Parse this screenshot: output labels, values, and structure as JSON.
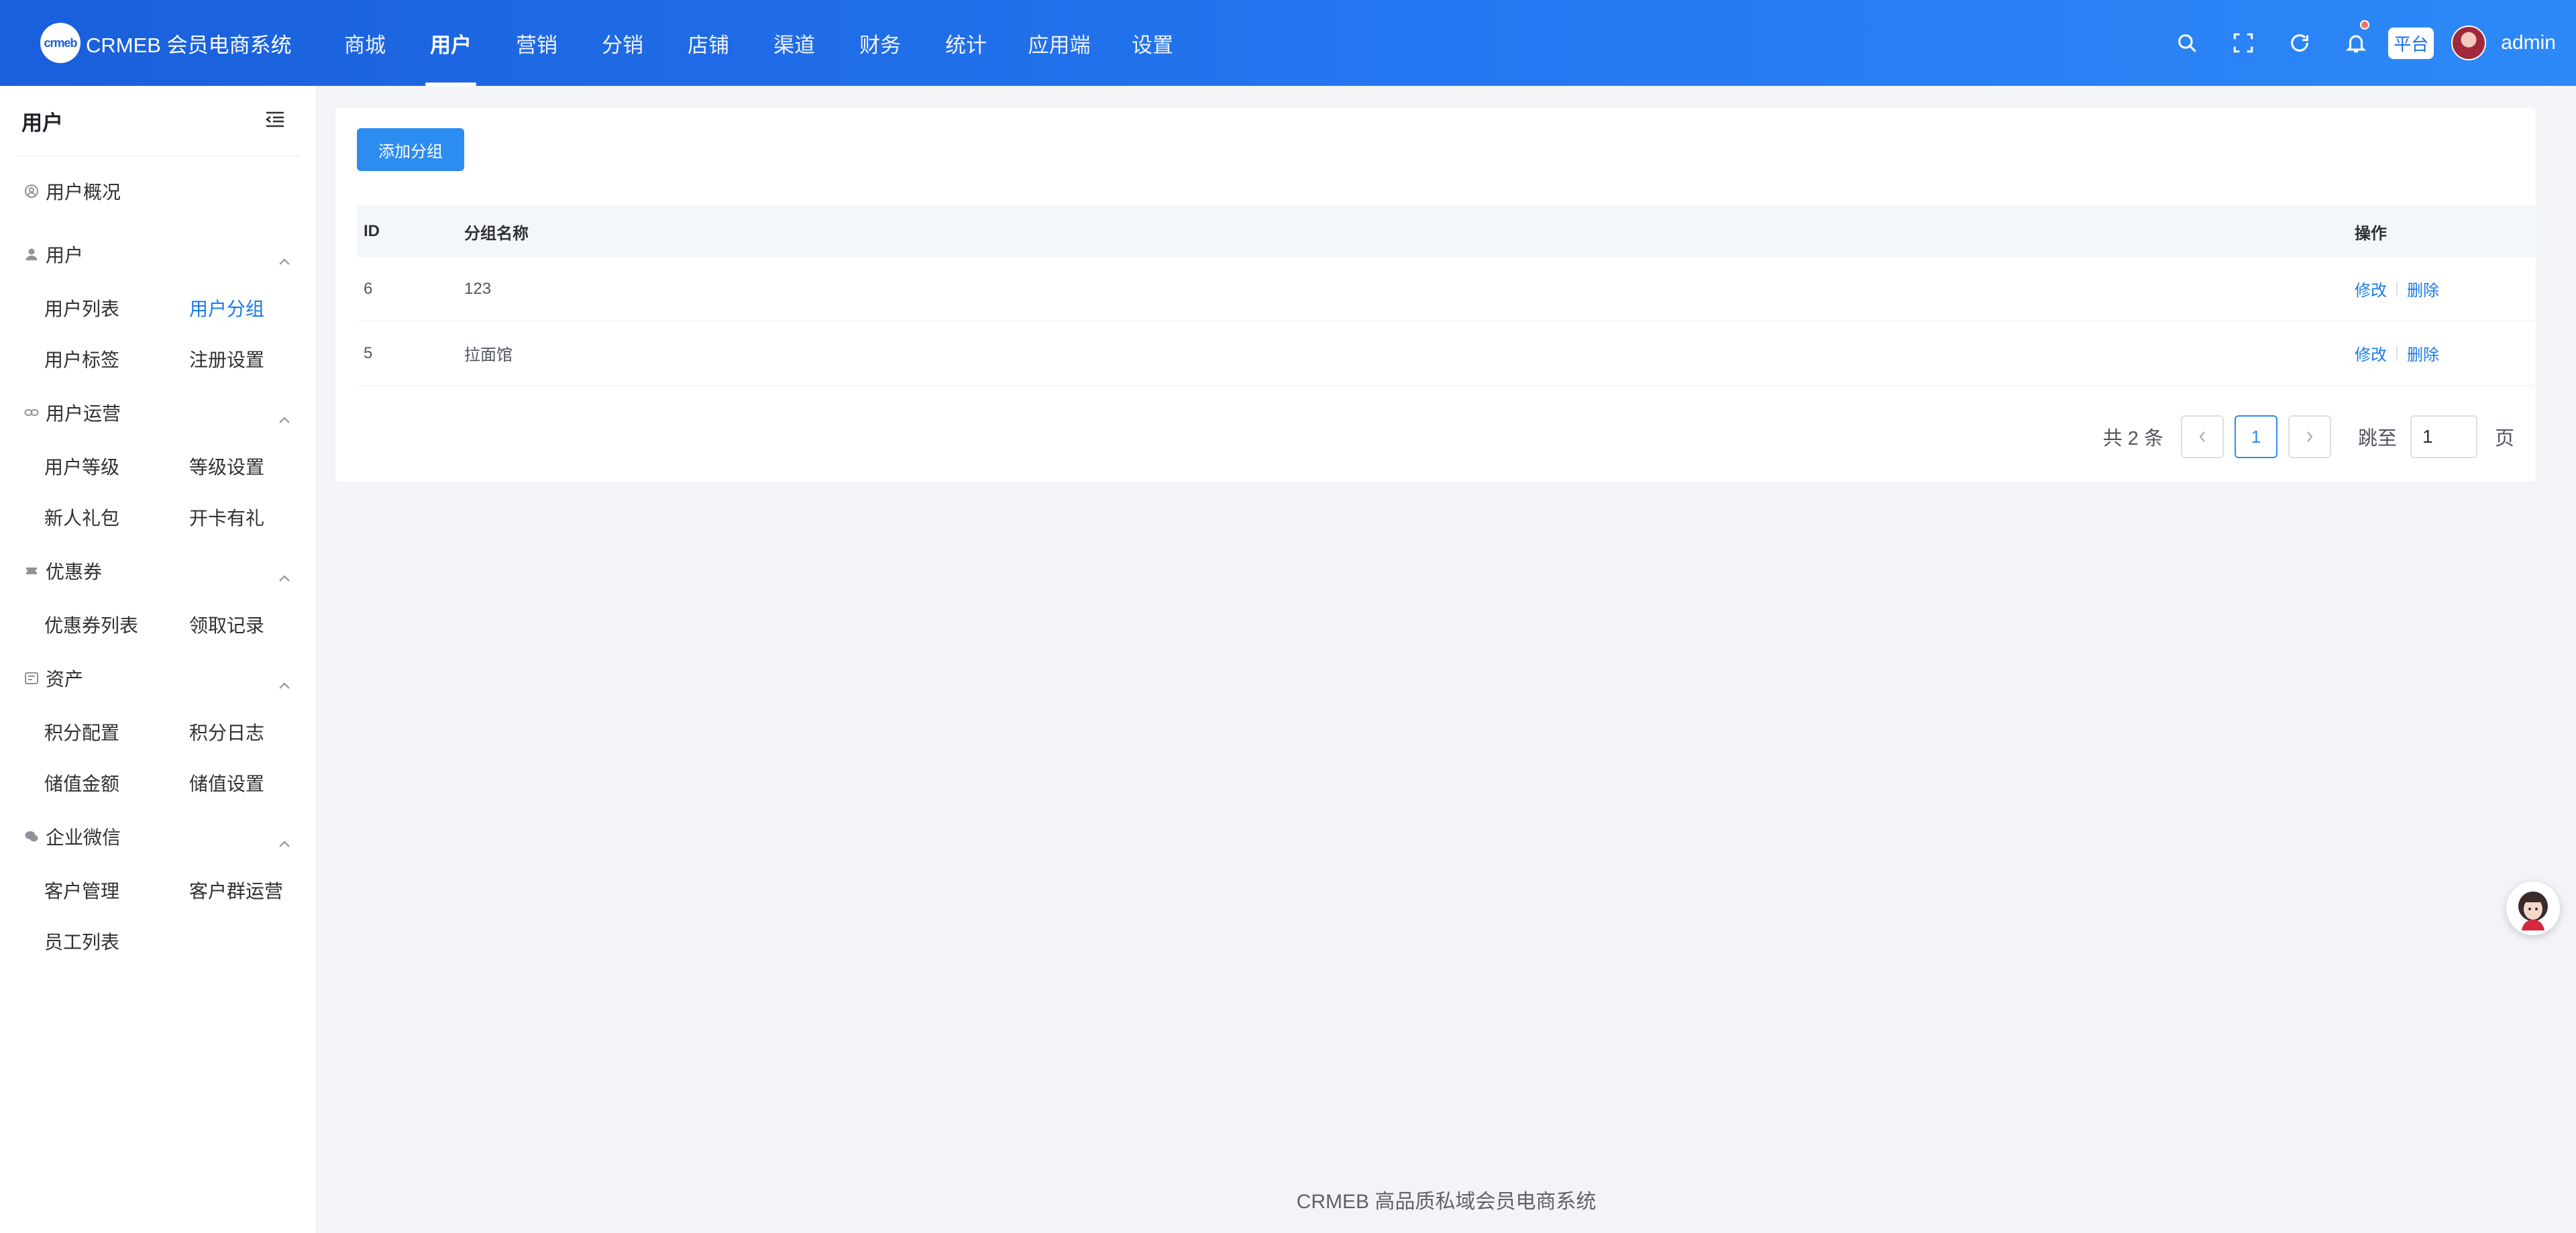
{
  "brand": {
    "logo_text": "crmeb",
    "name": "CRMEB 会员电商系统"
  },
  "topnav": {
    "items": [
      {
        "label": "商城"
      },
      {
        "label": "用户"
      },
      {
        "label": "营销"
      },
      {
        "label": "分销"
      },
      {
        "label": "店铺"
      },
      {
        "label": "渠道"
      },
      {
        "label": "财务"
      },
      {
        "label": "统计"
      },
      {
        "label": "应用端"
      },
      {
        "label": "设置"
      }
    ],
    "active": "用户"
  },
  "header_right": {
    "icons": [
      "search-icon",
      "fullscreen-icon",
      "refresh-icon",
      "bell-icon"
    ],
    "platform_badge": "平台",
    "username": "admin"
  },
  "sidebar": {
    "title": "用户",
    "overview": "用户概况",
    "groups": [
      {
        "label": "用户",
        "icon": "user-icon",
        "items": [
          "用户列表",
          "用户分组",
          "用户标签",
          "注册设置"
        ]
      },
      {
        "label": "用户运营",
        "icon": "link-icon",
        "items": [
          "用户等级",
          "等级设置",
          "新人礼包",
          "开卡有礼"
        ]
      },
      {
        "label": "优惠券",
        "icon": "coupon-icon",
        "items": [
          "优惠券列表",
          "领取记录"
        ]
      },
      {
        "label": "资产",
        "icon": "wallet-icon",
        "items": [
          "积分配置",
          "积分日志",
          "储值金额",
          "储值设置"
        ]
      },
      {
        "label": "企业微信",
        "icon": "wechat-icon",
        "items": [
          "客户管理",
          "客户群运营",
          "员工列表"
        ]
      }
    ],
    "active_item": "用户分组"
  },
  "main": {
    "add_button": "添加分组",
    "table": {
      "headers": {
        "id": "ID",
        "name": "分组名称",
        "ops": "操作"
      },
      "rows": [
        {
          "id": "6",
          "name": "123",
          "edit": "修改",
          "delete": "删除"
        },
        {
          "id": "5",
          "name": "拉面馆",
          "edit": "修改",
          "delete": "删除"
        }
      ]
    },
    "pager": {
      "total": "共 2 条",
      "current": "1",
      "jump_label": "跳至",
      "jump_value": "1",
      "page_word": "页"
    }
  },
  "footer": "CRMEB 高品质私域会员电商系统",
  "colors": {
    "header_start": "#1a5fdb",
    "header_end": "#2d89f8",
    "primary": "#2d8cf0",
    "link": "#1a7be8"
  }
}
